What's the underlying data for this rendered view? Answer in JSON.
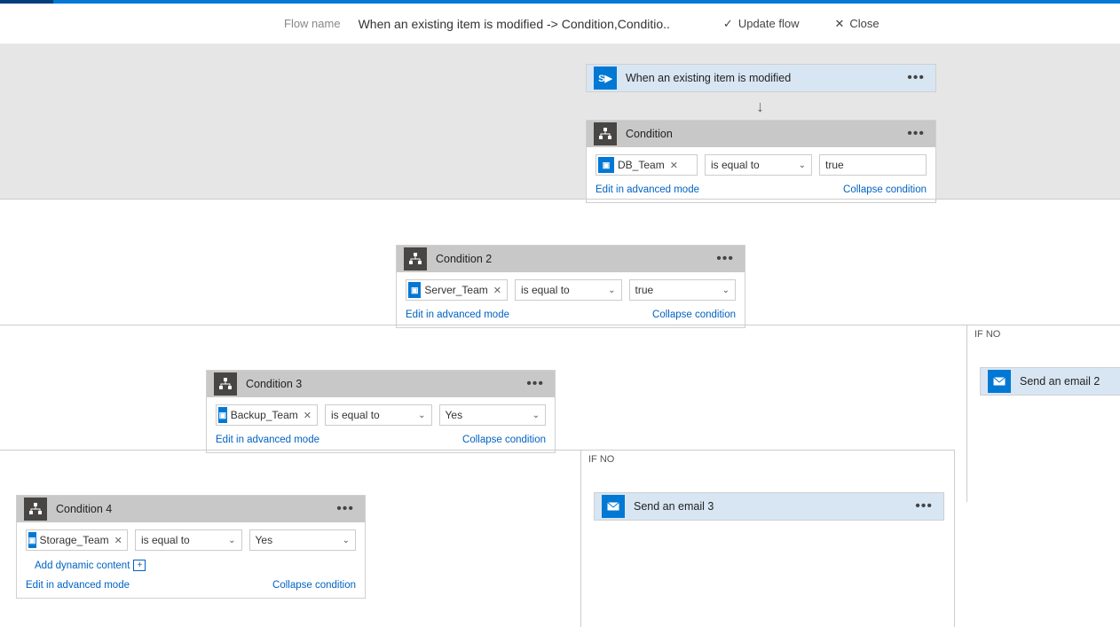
{
  "header": {
    "flow_label": "Flow name",
    "flow_name": "When an existing item is modified -> Condition,Conditio..",
    "update": "Update flow",
    "close": "Close"
  },
  "trigger": {
    "title": "When an existing item is modified"
  },
  "condition1": {
    "title": "Condition",
    "token": "DB_Team",
    "operator": "is equal to",
    "value": "true",
    "edit_link": "Edit in advanced mode",
    "collapse_link": "Collapse condition"
  },
  "condition2": {
    "title": "Condition 2",
    "token": "Server_Team",
    "operator": "is equal to",
    "value": "true",
    "edit_link": "Edit in advanced mode",
    "collapse_link": "Collapse condition"
  },
  "condition3": {
    "title": "Condition 3",
    "token": "Backup_Team",
    "operator": "is equal to",
    "value": "Yes",
    "edit_link": "Edit in advanced mode",
    "collapse_link": "Collapse condition"
  },
  "condition4": {
    "title": "Condition 4",
    "token": "Storage_Team",
    "operator": "is equal to",
    "value": "Yes",
    "add_dynamic": "Add dynamic content",
    "edit_link": "Edit in advanced mode",
    "collapse_link": "Collapse condition"
  },
  "ifno2": {
    "label": "IF NO",
    "action_title": "Send an email 2"
  },
  "ifno3": {
    "label": "IF NO",
    "action_title": "Send an email 3"
  }
}
